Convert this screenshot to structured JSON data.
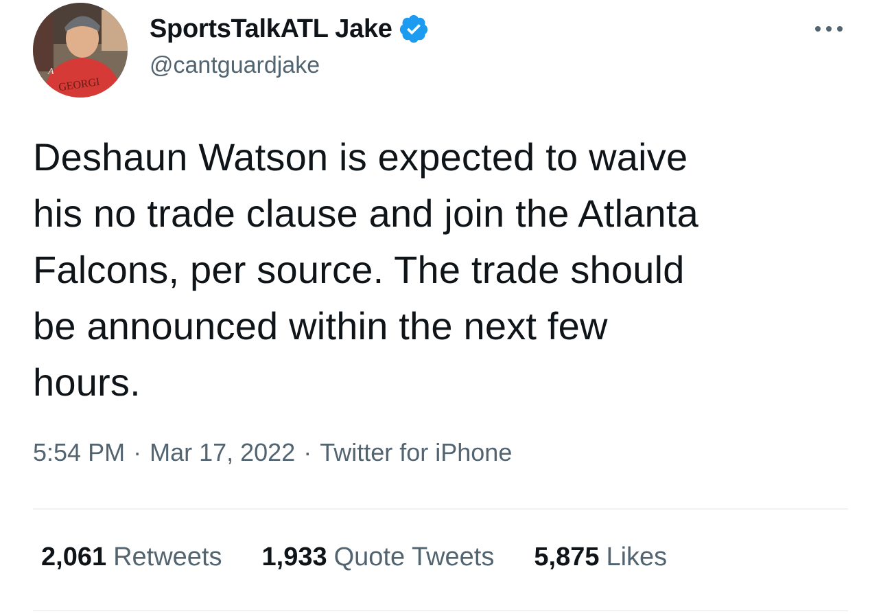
{
  "author": {
    "display_name": "SportsTalkATL Jake",
    "handle": "@cantguardjake",
    "verified": true,
    "avatar_shirt_text": "GEORGI"
  },
  "tweet": {
    "text": "Deshaun Watson is expected to waive\nhis no trade clause and join the Atlanta\nFalcons, per source. The trade should\nbe announced within the next few\nhours.",
    "time": "5:54 PM",
    "date": "Mar 17, 2022",
    "source": "Twitter for iPhone",
    "separator": "·"
  },
  "stats": [
    {
      "count": "2,061",
      "label": "Retweets"
    },
    {
      "count": "1,933",
      "label": "Quote Tweets"
    },
    {
      "count": "5,875",
      "label": "Likes"
    }
  ],
  "icons": {
    "verified": "verified-badge-icon",
    "more": "more-options-icon"
  },
  "colors": {
    "verified_blue": "#1d9bf0",
    "text_primary": "#0f1419",
    "text_secondary": "#536471",
    "divider": "#eff3f4"
  }
}
